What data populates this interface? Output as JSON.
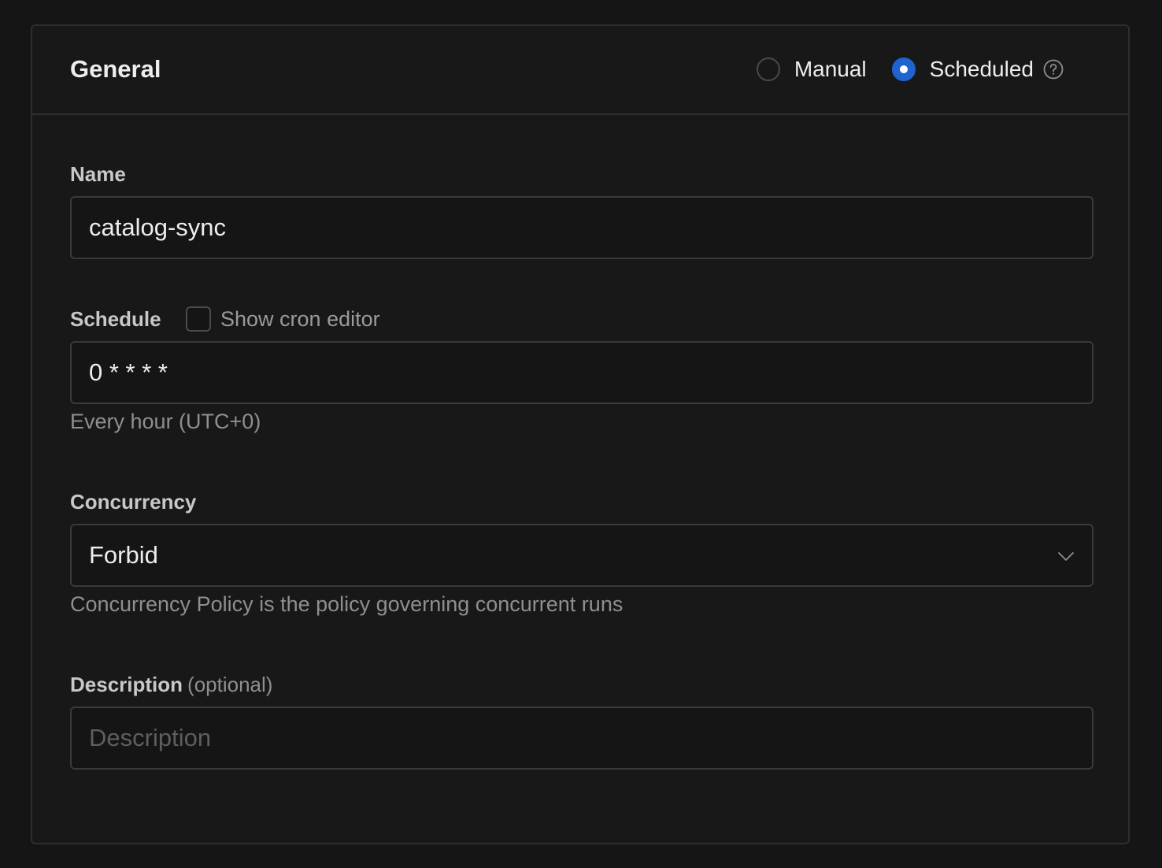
{
  "header": {
    "title": "General",
    "mode_options": [
      {
        "label": "Manual",
        "selected": false
      },
      {
        "label": "Scheduled",
        "selected": true
      }
    ],
    "accent_color": "#1f63d1"
  },
  "form": {
    "name": {
      "label": "Name",
      "value": "catalog-sync"
    },
    "schedule": {
      "label": "Schedule",
      "cron_editor_label": "Show cron editor",
      "cron_editor_checked": false,
      "value": "0 * * * *",
      "helper": "Every hour (UTC+0)"
    },
    "concurrency": {
      "label": "Concurrency",
      "value": "Forbid",
      "helper": "Concurrency Policy is the policy governing concurrent runs"
    },
    "description": {
      "label": "Description",
      "optional_label": "(optional)",
      "value": "",
      "placeholder": "Description"
    }
  },
  "icons": {
    "help": "question-circle-icon",
    "select": "chevron-down-icon"
  }
}
